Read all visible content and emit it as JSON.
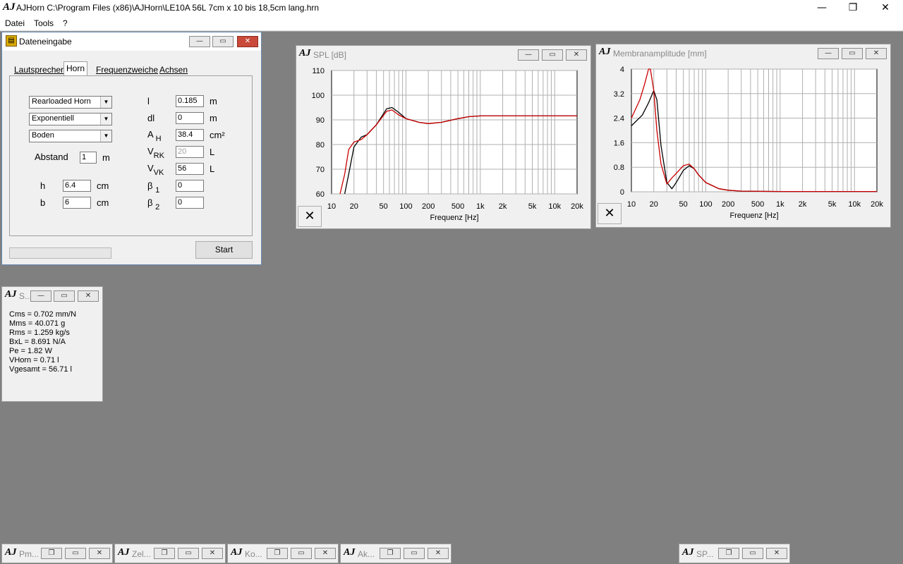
{
  "app": {
    "logo": "AJ",
    "title": "AJHorn  C:\\Program Files (x86)\\AJHorn\\LE10A 56L 7cm x 10 bis 18,5cm lang.hrn",
    "minimize": "—",
    "restore": "❐",
    "close": "✕"
  },
  "menu": {
    "file": "Datei",
    "tools": "Tools",
    "help": "?"
  },
  "dateneingabe": {
    "title": "Dateneingabe",
    "tabs": [
      "Lautsprecher",
      "Horn",
      "Frequenzweiche",
      "Achsen"
    ],
    "selects": {
      "horn_type": "Rearloaded Horn",
      "profile": "Exponentiell",
      "position": "Boden"
    },
    "abstand": {
      "label": "Abstand",
      "value": "1",
      "unit": "m"
    },
    "h": {
      "label": "h",
      "value": "6.4",
      "unit": "cm"
    },
    "b": {
      "label": "b",
      "value": "6",
      "unit": "cm"
    },
    "l": {
      "label": "l",
      "value": "0.185",
      "unit": "m"
    },
    "dl": {
      "label": "dl",
      "value": "0",
      "unit": "m"
    },
    "ah": {
      "label": "A",
      "sub": "H",
      "value": "38.4",
      "unit": "cm²"
    },
    "vrk": {
      "label": "V",
      "sub": "RK",
      "value": "20",
      "unit": "L"
    },
    "vvk": {
      "label": "V",
      "sub": "VK",
      "value": "56",
      "unit": "L"
    },
    "beta1": {
      "label": "β",
      "sub": "1",
      "value": "0"
    },
    "beta2": {
      "label": "β",
      "sub": "2",
      "value": "0"
    },
    "start": "Start"
  },
  "spl_window": {
    "title": "SPL [dB]",
    "xlabel": "Frequenz [Hz]",
    "close_x": "✕"
  },
  "amp_window": {
    "title": "Membranamplitude [mm]",
    "xlabel": "Frequenz [Hz]",
    "close_x": "✕"
  },
  "params_window": {
    "title": "S...",
    "lines": [
      "Cms = 0.702 mm/N",
      "Mms = 40.071 g",
      "Rms = 1.259 kg/s",
      "BxL = 8.691 N/A",
      "Pe = 1.82 W",
      "VHorn = 0.71 l",
      "Vgesamt = 56.71 l"
    ]
  },
  "minimized": [
    "Pm...",
    "Zel...",
    "Ko...",
    "Ak...",
    "SP..."
  ],
  "chart_data": [
    {
      "type": "line",
      "title": "SPL [dB]",
      "xlabel": "Frequenz [Hz]",
      "x_scale": "log",
      "xlim": [
        10,
        20000
      ],
      "ylim": [
        60,
        110
      ],
      "xticks": [
        "10",
        "20",
        "50",
        "100",
        "200",
        "500",
        "1k",
        "2k",
        "5k",
        "10k",
        "20k"
      ],
      "yticks": [
        "110",
        "100",
        "90",
        "80",
        "70",
        "60"
      ],
      "grid": true,
      "colors": {
        "black": "#000000",
        "red": "#cc0000"
      },
      "series": [
        {
          "color": "black",
          "x": [
            15,
            17,
            20,
            25,
            30,
            40,
            55,
            65,
            80,
            100,
            150,
            200,
            300,
            500,
            700,
            1000,
            2000,
            5000,
            20000
          ],
          "y": [
            60,
            68,
            79,
            83,
            84,
            88,
            94.5,
            95,
            93,
            90.5,
            89,
            88.5,
            89,
            90.5,
            91.3,
            91.6,
            91.6,
            91.6,
            91.6
          ]
        },
        {
          "color": "red",
          "x": [
            13,
            15,
            17,
            20,
            25,
            30,
            40,
            55,
            65,
            80,
            100,
            150,
            200,
            300,
            500,
            700,
            1000,
            2000,
            5000,
            20000
          ],
          "y": [
            60,
            68,
            78,
            81,
            82,
            84,
            88,
            93.5,
            94,
            92,
            90.5,
            89,
            88.5,
            89,
            90.5,
            91.3,
            91.6,
            91.6,
            91.6,
            91.6
          ]
        }
      ]
    },
    {
      "type": "line",
      "title": "Membranamplitude [mm]",
      "xlabel": "Frequenz [Hz]",
      "x_scale": "log",
      "xlim": [
        10,
        20000
      ],
      "ylim": [
        0,
        4
      ],
      "xticks": [
        "10",
        "20",
        "50",
        "100",
        "200",
        "500",
        "1k",
        "2k",
        "5k",
        "10k",
        "20k"
      ],
      "yticks": [
        "4",
        "3.2",
        "2.4",
        "1.6",
        "0.8",
        "0"
      ],
      "grid": true,
      "colors": {
        "black": "#000000",
        "red": "#cc0000"
      },
      "series": [
        {
          "color": "black",
          "x": [
            10,
            14,
            17,
            20,
            22,
            25,
            30,
            35,
            40,
            50,
            60,
            70,
            80,
            100,
            150,
            200,
            300,
            1000,
            20000
          ],
          "y": [
            2.15,
            2.5,
            2.9,
            3.3,
            3.0,
            1.5,
            0.3,
            0.1,
            0.3,
            0.7,
            0.85,
            0.75,
            0.55,
            0.3,
            0.1,
            0.05,
            0.02,
            0.01,
            0.01
          ]
        },
        {
          "color": "red",
          "x": [
            10,
            13,
            15,
            17,
            18,
            20,
            22,
            25,
            30,
            35,
            40,
            50,
            60,
            70,
            80,
            100,
            150,
            200,
            300,
            1000,
            20000
          ],
          "y": [
            2.4,
            3.0,
            3.5,
            4.0,
            4.0,
            3.3,
            2.0,
            0.9,
            0.25,
            0.45,
            0.6,
            0.85,
            0.9,
            0.75,
            0.55,
            0.3,
            0.1,
            0.05,
            0.02,
            0.01,
            0.01
          ]
        }
      ]
    }
  ]
}
